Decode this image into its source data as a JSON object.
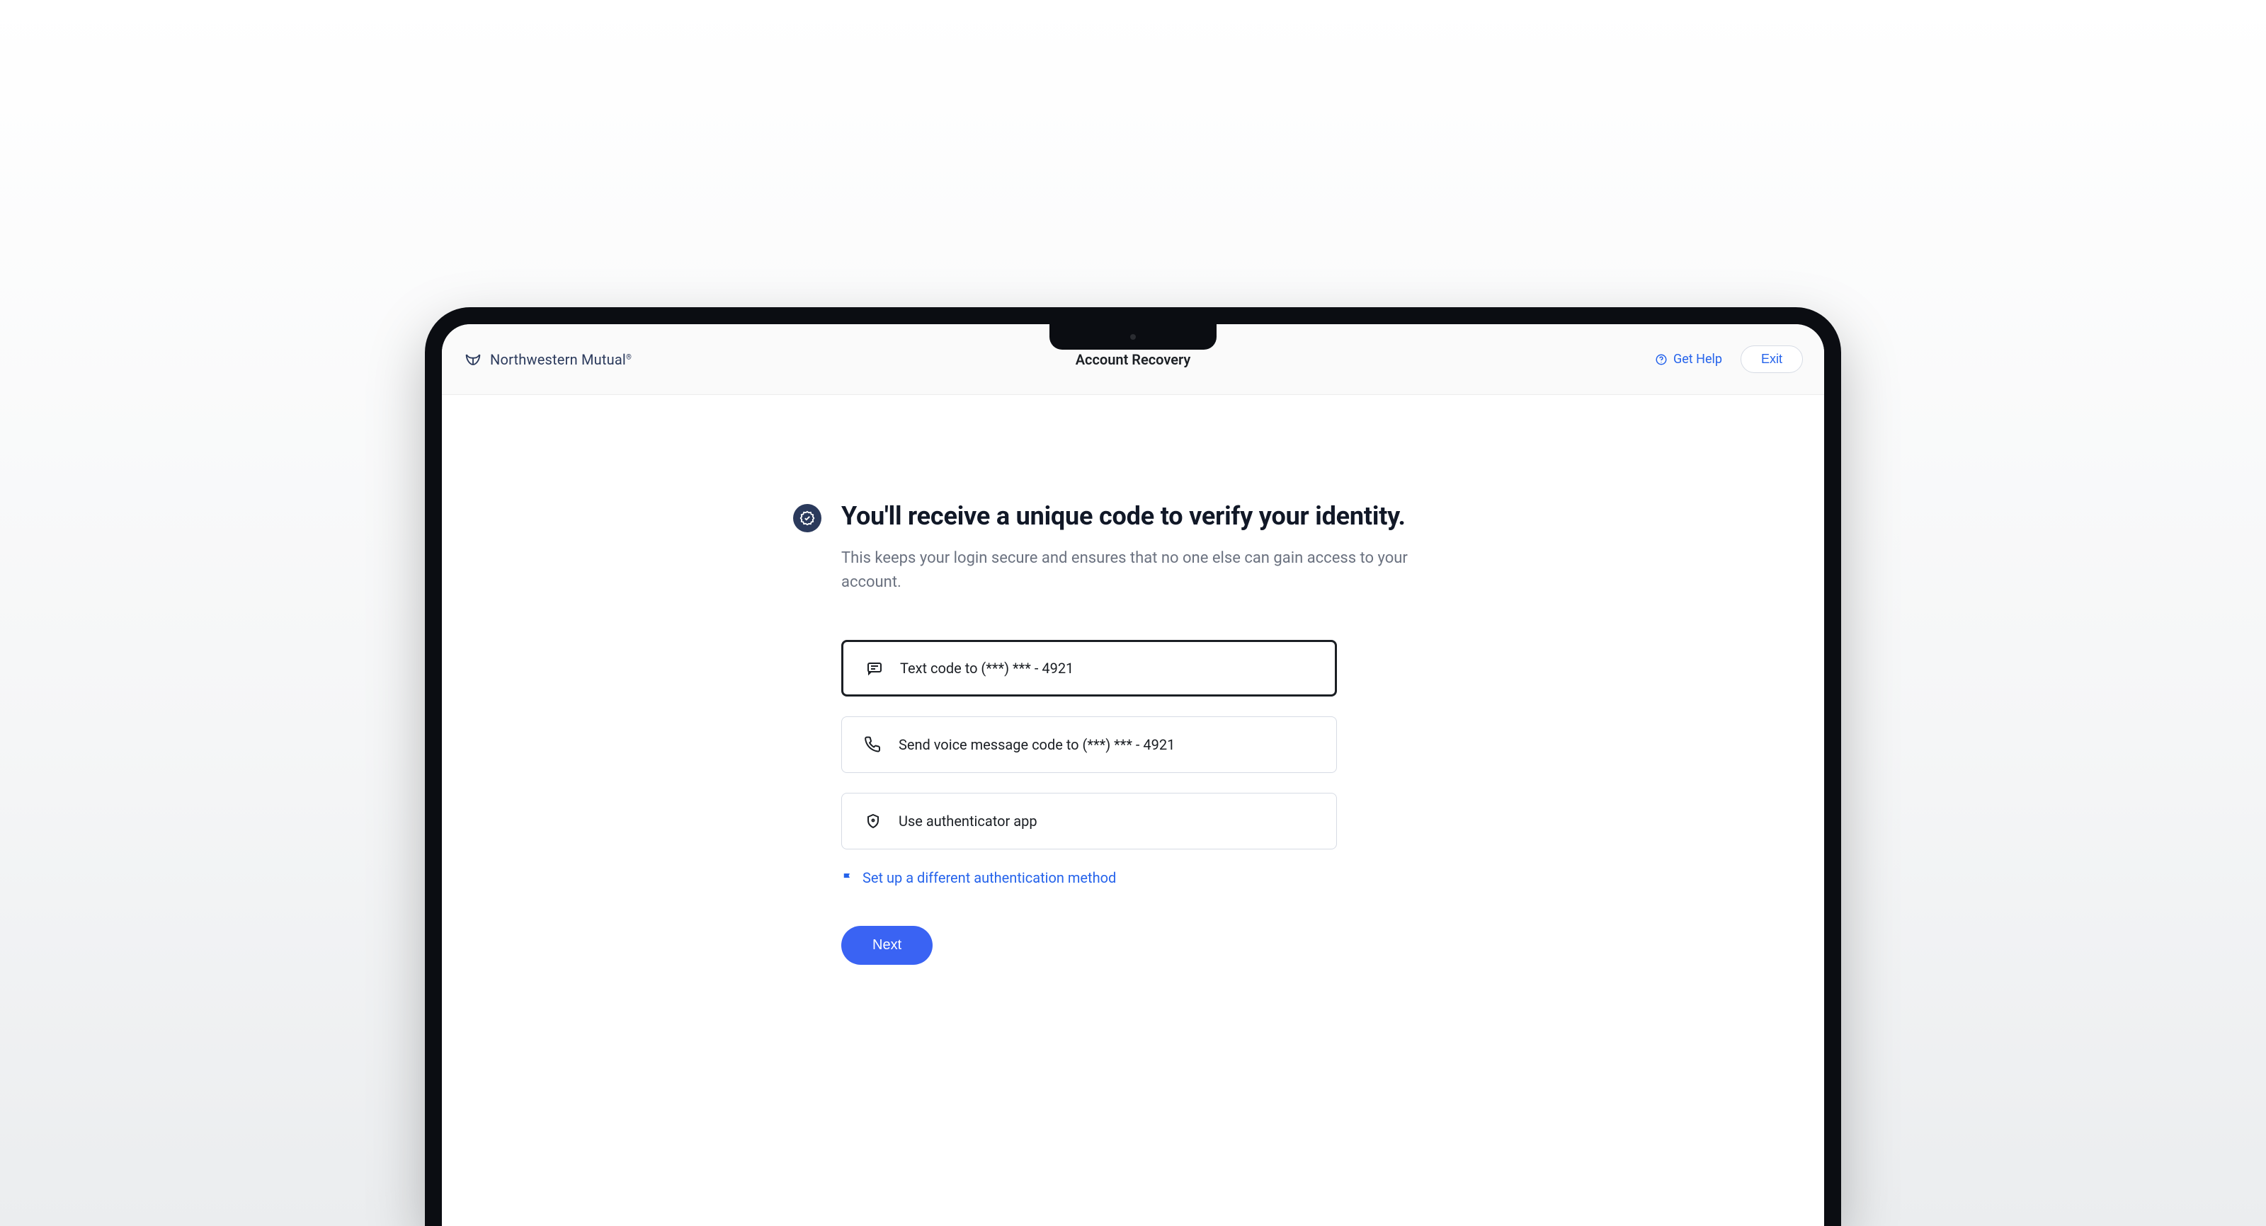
{
  "header": {
    "brand": "Northwestern Mutual",
    "title": "Account Recovery",
    "get_help": "Get Help",
    "exit": "Exit"
  },
  "main": {
    "heading": "You'll receive a unique code to verify your identity.",
    "subtitle": "This keeps your login secure and ensures that no one else can gain access to your account.",
    "options": [
      {
        "label": "Text code to (***) *** - 4921",
        "icon": "message-icon",
        "selected": true
      },
      {
        "label": "Send voice message code to (***) *** - 4921",
        "icon": "phone-icon",
        "selected": false
      },
      {
        "label": "Use authenticator app",
        "icon": "shield-icon",
        "selected": false
      }
    ],
    "alt_method": "Set up a different authentication method",
    "next": "Next"
  }
}
